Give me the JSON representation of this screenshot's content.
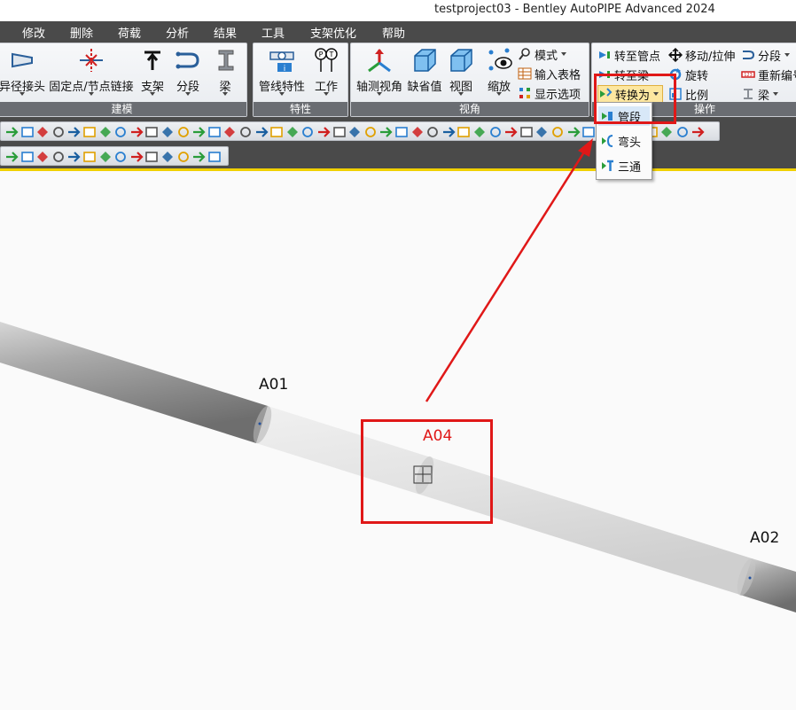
{
  "window": {
    "title": "testproject03 - Bentley AutoPIPE Advanced 2024"
  },
  "menu": [
    "修改",
    "删除",
    "荷载",
    "分析",
    "结果",
    "工具",
    "支架优化",
    "帮助"
  ],
  "ribbon": {
    "modeling": {
      "label": "建模",
      "reducer": "异径接头",
      "anchor_link": "固定点/节点链接",
      "support": "支架",
      "segment": "分段",
      "beam": "梁"
    },
    "properties": {
      "label": "特性",
      "pipe_props": "管线特性",
      "operating": "工作"
    },
    "view": {
      "label": "视角",
      "axis_view": "轴测视角",
      "default": "缺省值",
      "view": "视图",
      "zoom": "缩放",
      "mode": "模式",
      "input_grid": "输入表格",
      "display_options": "显示选项"
    },
    "operations": {
      "label": "操作",
      "goto_pipe": "转至管点",
      "goto_beam": "转至梁",
      "convert_to": "转换为",
      "move_stretch": "移动/拉伸",
      "rotate": "旋转",
      "scale": "比例",
      "segment": "分段",
      "renumber": "重新编号",
      "beam": "梁"
    }
  },
  "dropdown": {
    "items": [
      "管段",
      "弯头",
      "三通"
    ]
  },
  "viewport": {
    "nodes": {
      "a01": "A01",
      "a04": "A04",
      "a02": "A02"
    }
  },
  "colors": {
    "highlight": "#e01818",
    "menubar": "#4a4a4a",
    "accent_line": "#f0d000"
  }
}
